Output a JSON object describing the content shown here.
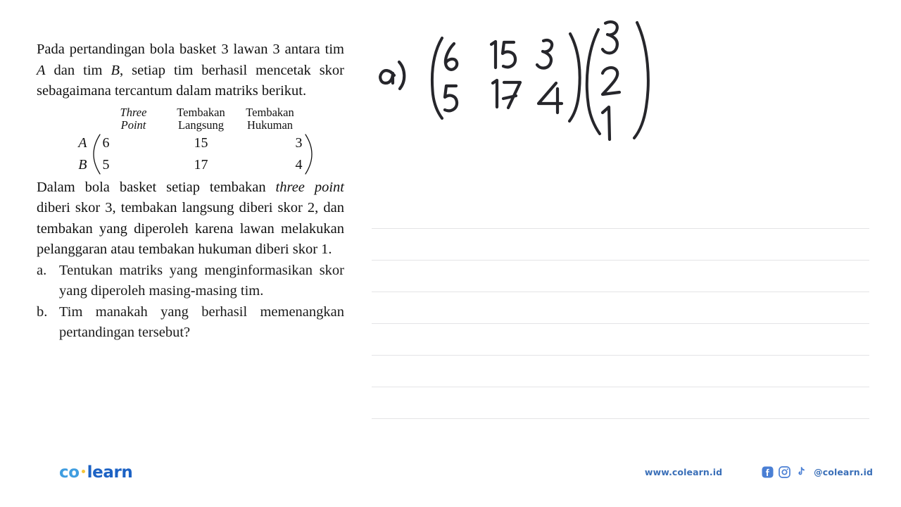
{
  "document": {
    "type": "worksheet-page",
    "background": "#ffffff"
  },
  "question": {
    "paragraph1_part1": "Pada pertandingan bola basket 3 lawan 3 antara tim ",
    "paragraph1_italic_a": "A",
    "paragraph1_part2": " dan tim ",
    "paragraph1_italic_b": "B",
    "paragraph1_part3": ", setiap tim berhasil mencetak skor sebagaimana tercantum dalam matriks berikut.",
    "paragraph2_part1": "Dalam bola basket setiap tembakan ",
    "paragraph2_italic": "three point",
    "paragraph2_part2": " diberi skor 3, tembakan langsung diberi skor 2, dan tembakan yang diperoleh karena lawan melakukan pelanggaran atau tembakan hukuman diberi skor 1.",
    "subquestions": [
      {
        "marker": "a.",
        "text": "Tentukan matriks yang menginformasikan skor yang diperoleh masing-masing tim."
      },
      {
        "marker": "b.",
        "text": "Tim manakah yang berhasil memenangkan pertandingan tersebut?"
      }
    ]
  },
  "matrix_table": {
    "column_headers": [
      {
        "line1": "Three",
        "line2": "Point",
        "style": "italic"
      },
      {
        "line1": "Tembakan",
        "line2": "Langsung",
        "style": "regular"
      },
      {
        "line1": "Tembakan",
        "line2": "Hukuman",
        "style": "regular"
      }
    ],
    "row_labels": [
      "A",
      "B"
    ],
    "rows": [
      [
        "6",
        "15",
        "3"
      ],
      [
        "5",
        "17",
        "4"
      ]
    ]
  },
  "handwriting": {
    "label": "a)",
    "matrix": {
      "rows": [
        [
          "6",
          "15",
          "3"
        ],
        [
          "5",
          "17",
          "4"
        ]
      ]
    },
    "vector": {
      "values": [
        "3",
        "2",
        "1"
      ]
    },
    "ink_color": "#26262b"
  },
  "answer_area": {
    "rule_line_color": "#e4e4e6",
    "rule_line_y": [
      324,
      369,
      414,
      459,
      504,
      549,
      594
    ]
  },
  "footer": {
    "logo": {
      "part1": "co",
      "separator": "·",
      "part2": "learn",
      "color_part1": "#3f9de0",
      "color_dot": "#f5c53a",
      "color_part2": "#1c62c4"
    },
    "website": "www.colearn.id",
    "handle": "@colearn.id",
    "social_icons": [
      "facebook-icon",
      "instagram-icon",
      "tiktok-icon"
    ],
    "text_color": "#3a6fb8"
  }
}
